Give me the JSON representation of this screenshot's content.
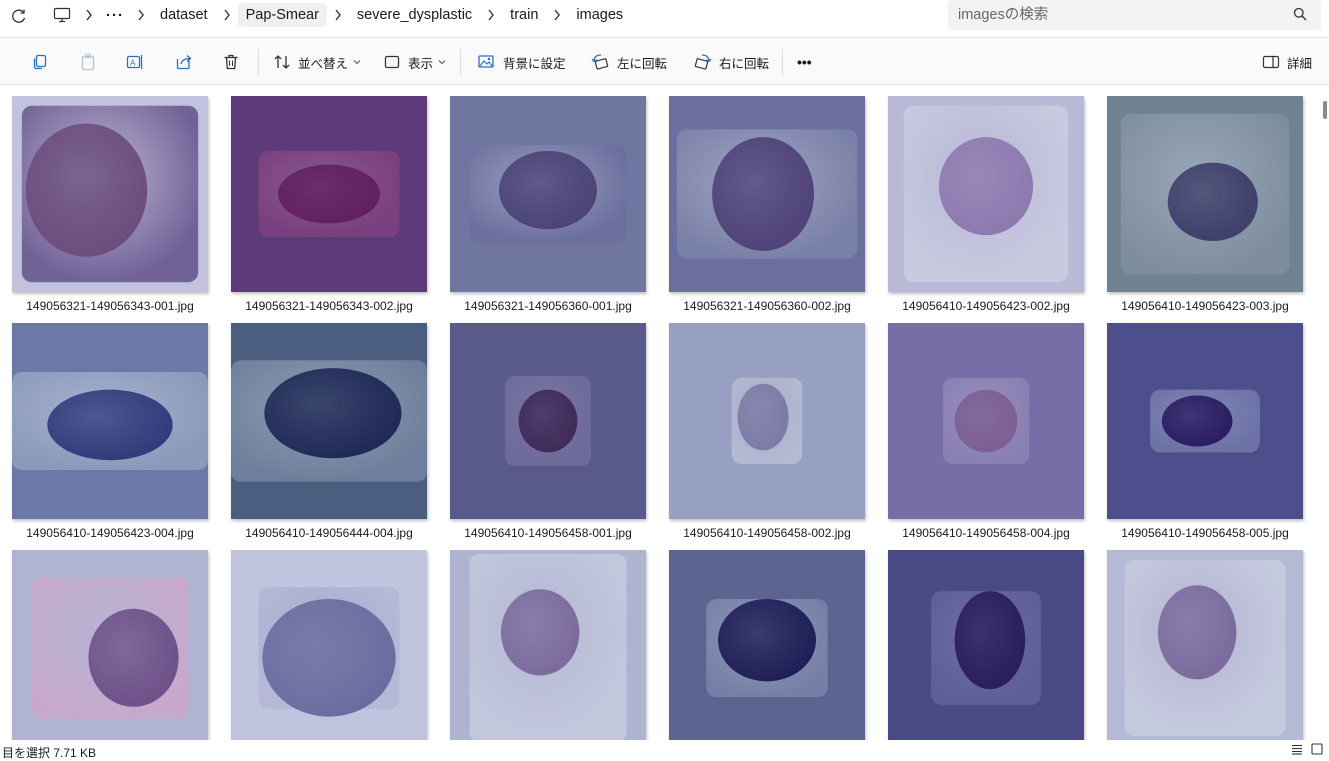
{
  "address": {
    "breadcrumbs": [
      "dataset",
      "Pap-Smear",
      "severe_dysplastic",
      "train",
      "images"
    ],
    "overflow_label": "···"
  },
  "search": {
    "placeholder": "imagesの検索"
  },
  "toolbar": {
    "sort_label": "並べ替え",
    "view_label": "表示",
    "set_background_label": "背景に設定",
    "rotate_left_label": "左に回転",
    "rotate_right_label": "右に回転",
    "more_label": "•••",
    "details_label": "詳細"
  },
  "files": [
    {
      "name": "149056321-149056343-001.jpg",
      "bg": "#c3c2de",
      "cell": "#6d5d92",
      "inner": "#b9b5d6",
      "cw": 0.9,
      "ch": 0.9,
      "nw": 0.62,
      "nh": 0.68,
      "nc": "#6c4e7e",
      "nx": 0.38,
      "ny": 0.48
    },
    {
      "name": "149056321-149056343-002.jpg",
      "bg": "#5d3b78",
      "cell": "#7b3f7e",
      "inner": "#8a5c93",
      "cw": 0.72,
      "ch": 0.44,
      "nw": 0.52,
      "nh": 0.3,
      "nc": "#61215e",
      "nx": 0.5,
      "ny": 0.5
    },
    {
      "name": "149056321-149056360-001.jpg",
      "bg": "#6f76a0",
      "cell": "#6c6f9c",
      "inner": "#9aa2c2",
      "cw": 0.8,
      "ch": 0.5,
      "nw": 0.5,
      "nh": 0.4,
      "nc": "#4c4477",
      "nx": 0.5,
      "ny": 0.48
    },
    {
      "name": "149056321-149056360-002.jpg",
      "bg": "#6b6f9e",
      "cell": "#7b82a8",
      "inner": "#a1a7c3",
      "cw": 0.92,
      "ch": 0.66,
      "nw": 0.52,
      "nh": 0.58,
      "nc": "#4f4277",
      "nx": 0.48,
      "ny": 0.5
    },
    {
      "name": "149056410-149056423-002.jpg",
      "bg": "#b7b9d6",
      "cell": "#c9cbe0",
      "inner": "#b8b6d6",
      "cw": 0.84,
      "ch": 0.9,
      "nw": 0.48,
      "nh": 0.5,
      "nc": "#8d78ae",
      "nx": 0.5,
      "ny": 0.46
    },
    {
      "name": "149056410-149056423-003.jpg",
      "bg": "#6e8290",
      "cell": "#7f8fa0",
      "inner": "#9aa8b8",
      "cw": 0.86,
      "ch": 0.82,
      "nw": 0.46,
      "nh": 0.4,
      "nc": "#3e3f6a",
      "nx": 0.54,
      "ny": 0.54
    },
    {
      "name": "149056410-149056423-004.jpg",
      "bg": "#6c78a8",
      "cell": "#8d9cbc",
      "inner": "#a8b3cf",
      "cw": 1.0,
      "ch": 0.5,
      "nw": 0.64,
      "nh": 0.36,
      "nc": "#313b7b",
      "nx": 0.5,
      "ny": 0.52
    },
    {
      "name": "149056410-149056444-004.jpg",
      "bg": "#4b5e80",
      "cell": "#6f819d",
      "inner": "#91a0b8",
      "cw": 1.0,
      "ch": 0.62,
      "nw": 0.7,
      "nh": 0.46,
      "nc": "#1e2a55",
      "nx": 0.52,
      "ny": 0.46
    },
    {
      "name": "149056410-149056458-001.jpg",
      "bg": "#5a5a8a",
      "cell": "#6e6a99",
      "inner": "#7c78a6",
      "cw": 0.44,
      "ch": 0.46,
      "nw": 0.3,
      "nh": 0.32,
      "nc": "#402a58",
      "nx": 0.5,
      "ny": 0.5
    },
    {
      "name": "149056410-149056458-002.jpg",
      "bg": "#97a0c0",
      "cell": "#b6bbd4",
      "inner": "#a7aac8",
      "cw": 0.36,
      "ch": 0.44,
      "nw": 0.26,
      "nh": 0.34,
      "nc": "#7c7aa5",
      "nx": 0.48,
      "ny": 0.48
    },
    {
      "name": "149056410-149056458-004.jpg",
      "bg": "#786ea7",
      "cell": "#8a80b3",
      "inner": "#9b90bd",
      "cw": 0.44,
      "ch": 0.44,
      "nw": 0.32,
      "nh": 0.32,
      "nc": "#7d5f93",
      "nx": 0.5,
      "ny": 0.5
    },
    {
      "name": "149056410-149056458-005.jpg",
      "bg": "#4d4f8c",
      "cell": "#6f74a6",
      "inner": "#8389b8",
      "cw": 0.56,
      "ch": 0.32,
      "nw": 0.36,
      "nh": 0.26,
      "nc": "#2a1c60",
      "nx": 0.46,
      "ny": 0.5
    },
    {
      "name": "",
      "bg": "#b0b4d2",
      "cell": "#c8a8cc",
      "inner": "#b6b4d2",
      "cw": 0.8,
      "ch": 0.72,
      "nw": 0.46,
      "nh": 0.5,
      "nc": "#6c5088",
      "nx": 0.62,
      "ny": 0.55
    },
    {
      "name": "",
      "bg": "#c1c4de",
      "cell": "#b5b8d6",
      "inner": "#a7a9cc",
      "cw": 0.72,
      "ch": 0.62,
      "nw": 0.68,
      "nh": 0.6,
      "nc": "#6b6a9e",
      "nx": 0.5,
      "ny": 0.55
    },
    {
      "name": "",
      "bg": "#aeb3d0",
      "cell": "#c5c9de",
      "inner": "#b4b6d3",
      "cw": 0.8,
      "ch": 0.96,
      "nw": 0.4,
      "nh": 0.44,
      "nc": "#7a6a9c",
      "nx": 0.46,
      "ny": 0.42
    },
    {
      "name": "",
      "bg": "#5b6590",
      "cell": "#7882a8",
      "inner": "#9099b8",
      "cw": 0.62,
      "ch": 0.5,
      "nw": 0.5,
      "nh": 0.42,
      "nc": "#1f1d56",
      "nx": 0.5,
      "ny": 0.46
    },
    {
      "name": "",
      "bg": "#4a4a86",
      "cell": "#5f609a",
      "inner": "#6e6fa5",
      "cw": 0.56,
      "ch": 0.58,
      "nw": 0.36,
      "nh": 0.5,
      "nc": "#2b1e5a",
      "nx": 0.52,
      "ny": 0.46
    },
    {
      "name": "",
      "bg": "#b4b9d6",
      "cell": "#c7cbdf",
      "inner": "#b3b3d2",
      "cw": 0.82,
      "ch": 0.9,
      "nw": 0.4,
      "nh": 0.48,
      "nc": "#7a6a9d",
      "nx": 0.46,
      "ny": 0.42
    }
  ],
  "status": {
    "text": "目を選択  7.71 KB"
  }
}
